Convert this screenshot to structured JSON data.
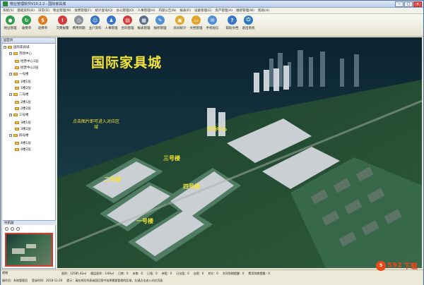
{
  "window": {
    "title": "物业管理软件V10.2.2 - 国际家具城"
  },
  "menu": [
    "系统(S)",
    "基础资料(B)",
    "日常(D)",
    "物业管理(M)",
    "收费管理(F)",
    "统计查询(Q)",
    "办公管理(O)",
    "人事管理(H)",
    "内部公告(N)",
    "报表(R)",
    "设备管理(E)",
    "资产管理(A)",
    "维修管理(W)",
    "帮助(H)"
  ],
  "toolbar": [
    {
      "label": "地址管理",
      "icon": "location-icon",
      "color": "#2e9b4a",
      "glyph": "●"
    },
    {
      "label": "收费单",
      "icon": "refresh-icon",
      "color": "#2e9b4a",
      "glyph": "↻"
    },
    {
      "label": "退费单",
      "icon": "money-icon",
      "color": "#e07a1f",
      "glyph": "$"
    },
    {
      "label": "",
      "icon": "",
      "color": "",
      "glyph": ""
    },
    {
      "label": "交费报警",
      "icon": "alarm-icon",
      "color": "#d23b3b",
      "glyph": "!"
    },
    {
      "label": "费用到期",
      "icon": "clock-icon",
      "color": "#8a8f99",
      "glyph": "◷"
    },
    {
      "label": "业户资料",
      "icon": "user-icon",
      "color": "#3874c8",
      "glyph": "☺"
    },
    {
      "label": "人事管理",
      "icon": "person-icon",
      "color": "#3874c8",
      "glyph": "♟"
    },
    {
      "label": "合同管理",
      "icon": "contract-icon",
      "color": "#d23b3b",
      "glyph": "▤"
    },
    {
      "label": "报表管理",
      "icon": "report-icon",
      "color": "#5a6e8c",
      "glyph": "▦"
    },
    {
      "label": "报修管理",
      "icon": "repair-icon",
      "color": "#4f8fd6",
      "glyph": "✎"
    },
    {
      "label": "",
      "icon": "",
      "color": "",
      "glyph": ""
    },
    {
      "label": "房间统计",
      "icon": "folder-icon",
      "color": "#e0a52a",
      "glyph": "▣"
    },
    {
      "label": "文档管理",
      "icon": "doc-icon",
      "color": "#e0a52a",
      "glyph": "▭"
    },
    {
      "label": "手机短信",
      "icon": "phone-icon",
      "color": "#4f8fd6",
      "glyph": "✉"
    },
    {
      "label": "",
      "icon": "",
      "color": "",
      "glyph": ""
    },
    {
      "label": "帮助文档",
      "icon": "help-icon",
      "color": "#3874c8",
      "glyph": "?"
    },
    {
      "label": "退出系统",
      "icon": "exit-icon",
      "color": "#2e7bc4",
      "glyph": "⏻"
    }
  ],
  "sidebar": {
    "header": "园区树",
    "nodes": [
      {
        "label": "国际家具城",
        "level": 0
      },
      {
        "label": "市场中心",
        "level": 1
      },
      {
        "label": "经营中心1层",
        "level": 2
      },
      {
        "label": "经营中心2层",
        "level": 2
      },
      {
        "label": "一号楼",
        "level": 1
      },
      {
        "label": "1楼1层",
        "level": 2
      },
      {
        "label": "1楼2层",
        "level": 2
      },
      {
        "label": "二号楼",
        "level": 1
      },
      {
        "label": "2楼1层",
        "level": 2
      },
      {
        "label": "2楼2层",
        "level": 2
      },
      {
        "label": "三号楼",
        "level": 1
      },
      {
        "label": "3楼1层",
        "level": 2
      },
      {
        "label": "3楼2层",
        "level": 2
      },
      {
        "label": "四号楼",
        "level": 1
      },
      {
        "label": "4楼1层",
        "level": 2
      },
      {
        "label": "4楼2层",
        "level": 2
      }
    ],
    "nav_header": "导航器"
  },
  "main": {
    "title": "国际家具城",
    "hint": "点击图片即可进入对应区域",
    "labels": {
      "center": "市场中心",
      "b1": "一号楼",
      "b2": "二号楼",
      "b3": "三号楼",
      "b4": "四号楼"
    }
  },
  "status": {
    "left_tag": "就绪",
    "row1": [
      "面积：12585.42㎡",
      "楼层面积：3.60㎡",
      "已售：0",
      "未售：0",
      "已租：0",
      "待租：0",
      "已出租：0",
      "自营：0",
      "其它：0",
      "合同到期提醒：0",
      "费用到期提醒：0"
    ],
    "row2": [
      "操作员：系统管理员",
      "登录时间：2018-12-20",
      "提示：请在树形列表或园区图中选择需要管理的区域，左键点击进入对应页面"
    ]
  },
  "watermark": {
    "number": "592",
    "suffix": "下载"
  }
}
